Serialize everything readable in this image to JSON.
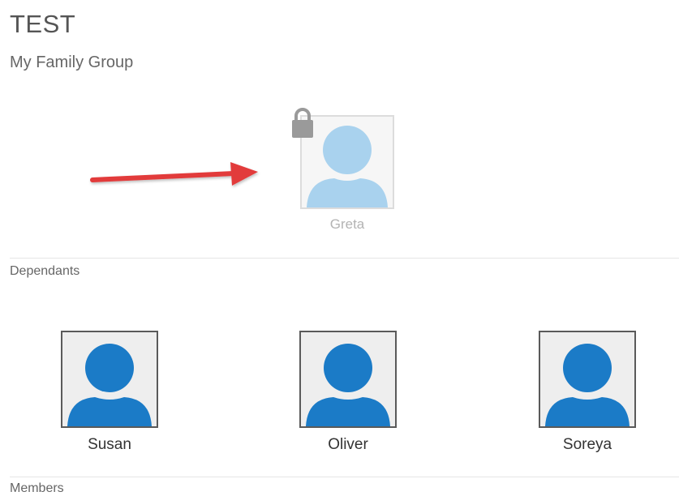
{
  "page": {
    "title": "TEST",
    "subtitle": "My Family Group"
  },
  "primary_member": {
    "name": "Greta",
    "locked": true,
    "icon": "lock-icon"
  },
  "sections": {
    "dependants_label": "Dependants",
    "members_label": "Members"
  },
  "dependants": [
    {
      "name": "Susan"
    },
    {
      "name": "Oliver"
    },
    {
      "name": "Soreya"
    }
  ],
  "colors": {
    "avatar_blue": "#1b7bc7",
    "avatar_faded": "#a9d2ee",
    "arrow_red": "#e23b3b",
    "lock_gray": "#9a9a9a"
  }
}
